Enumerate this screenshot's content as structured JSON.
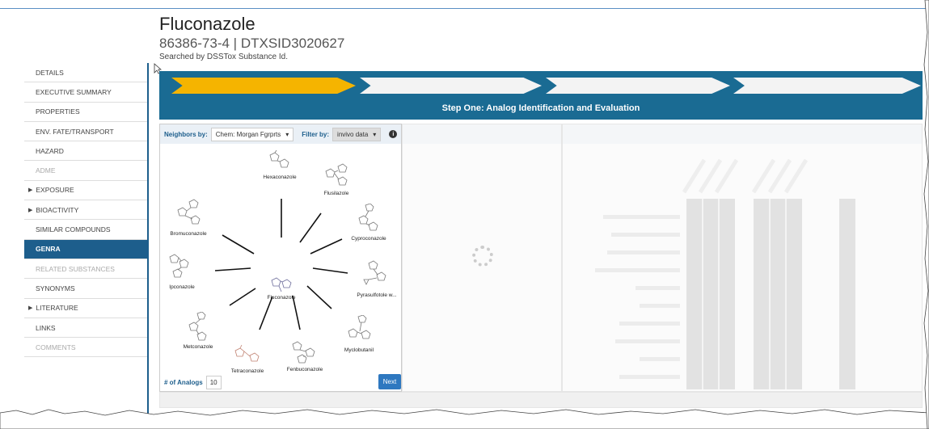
{
  "header": {
    "title": "Fluconazole",
    "subtitle": "86386-73-4 | DTXSID3020627",
    "searched": "Searched by DSSTox Substance Id."
  },
  "sidebar": {
    "items": [
      {
        "label": "DETAILS"
      },
      {
        "label": "EXECUTIVE SUMMARY"
      },
      {
        "label": "PROPERTIES"
      },
      {
        "label": "ENV. FATE/TRANSPORT"
      },
      {
        "label": "HAZARD"
      },
      {
        "label": "ADME"
      },
      {
        "label": "EXPOSURE"
      },
      {
        "label": "BIOACTIVITY"
      },
      {
        "label": "SIMILAR COMPOUNDS"
      },
      {
        "label": "GENRA"
      },
      {
        "label": "RELATED SUBSTANCES"
      },
      {
        "label": "SYNONYMS"
      },
      {
        "label": "LITERATURE"
      },
      {
        "label": "LINKS"
      },
      {
        "label": "COMMENTS"
      }
    ]
  },
  "steps": {
    "title": "Step One: Analog Identification and Evaluation"
  },
  "panel": {
    "neighbors_label": "Neighbors by:",
    "neighbors_value": "Chem: Morgan Fgrprts",
    "filter_label": "Filter by:",
    "filter_value": "invivo data",
    "center": "Fluconazole",
    "analogs": [
      {
        "name": "Hexaconazole"
      },
      {
        "name": "Flusilazole"
      },
      {
        "name": "Cyproconazole"
      },
      {
        "name": "Pyrasulfotole w..."
      },
      {
        "name": "Myclobutanil"
      },
      {
        "name": "Fenbuconazole"
      },
      {
        "name": "Tetraconazole"
      },
      {
        "name": "Metconazole"
      },
      {
        "name": "Ipconazole"
      },
      {
        "name": "Bromuconazole"
      }
    ],
    "num_analogs_label": "# of Analogs",
    "num_analogs_value": "10",
    "next_label": "Next"
  },
  "colors": {
    "accent": "#1d5e8c",
    "step_active": "#f5b400",
    "step_bar": "#1a6b93"
  }
}
